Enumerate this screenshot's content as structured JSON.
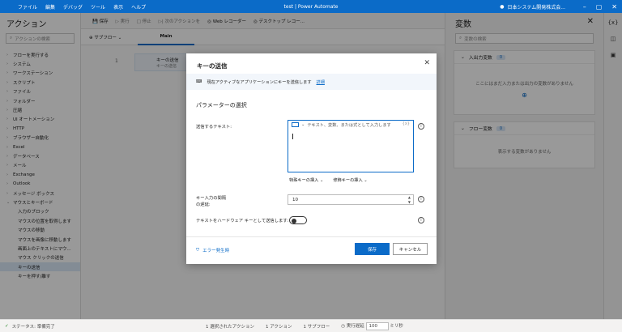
{
  "titlebar": {
    "menu": [
      "ファイル",
      "編集",
      "デバッグ",
      "ツール",
      "表示",
      "ヘルプ"
    ],
    "title": "test | Power Automate",
    "user": "日本システム開発株式会..."
  },
  "actions": {
    "title": "アクション",
    "search_placeholder": "アクションの検索",
    "groups": [
      "フローを実行する",
      "システム",
      "ワークステーション",
      "スクリプト",
      "ファイル",
      "フォルダー",
      "圧縮",
      "UI オートメーション",
      "HTTP",
      "ブラウザー自動化",
      "Excel",
      "データベース",
      "メール",
      "Exchange",
      "Outlook",
      "メッセージ ボックス",
      "マウスとキーボード"
    ],
    "sub_items": [
      "入力のブロック",
      "マウスの位置を取得します",
      "マウスの移動",
      "マウスを画像に移動します",
      "画面上のテキストにマウ...",
      "マウス クリックの送信",
      "キーの送信",
      "キーを押す/離す"
    ]
  },
  "toolbar": {
    "save": "保存",
    "run": "実行",
    "stop": "停止",
    "next": "次のアクションを",
    "web_recorder": "Web レコーダー",
    "desktop_recorder": "デスクトップ レコー..."
  },
  "tabs": {
    "subflow": "サブフロー",
    "main": "Main"
  },
  "canvas": {
    "line": "1",
    "step_title": "キーの送信",
    "step_sub": "キーの送信"
  },
  "variables": {
    "title": "変数",
    "search_placeholder": "変数の検索",
    "io_title": "入出力変数",
    "io_count": "0",
    "io_empty": "ここにはまだ入力または出力の変数がありません",
    "flow_title": "フロー変数",
    "flow_count": "0",
    "flow_empty": "表示する変数がありません"
  },
  "rail": {
    "vars": "{x}"
  },
  "status": {
    "state": "ステータス: 準備完了",
    "selected": "1 選択されたアクション",
    "actions": "1 アクション",
    "subflows": "1 サブフロー",
    "delay_label": "実行遅延",
    "delay": "100",
    "unit": "ミリ秒"
  },
  "dialog": {
    "title": "キーの送信",
    "info": "現在アクティブなアプリケーションにキーを送信します",
    "info_link": "詳細",
    "params_title": "パラメーターの選択",
    "text_label": "送信するテキスト:",
    "text_placeholder": "テキスト、変数、または式として入力します",
    "special_keys": "特殊キーの挿入",
    "modifier_keys": "修飾キーの挿入",
    "delay_label_1": "キー入力の間隔",
    "delay_label_2": "の遅延:",
    "delay_value": "10",
    "hardware_label": "テキストをハードウェア キーとして送信します:",
    "on_error": "エラー発生時",
    "save": "保存",
    "cancel": "キャンセル"
  }
}
